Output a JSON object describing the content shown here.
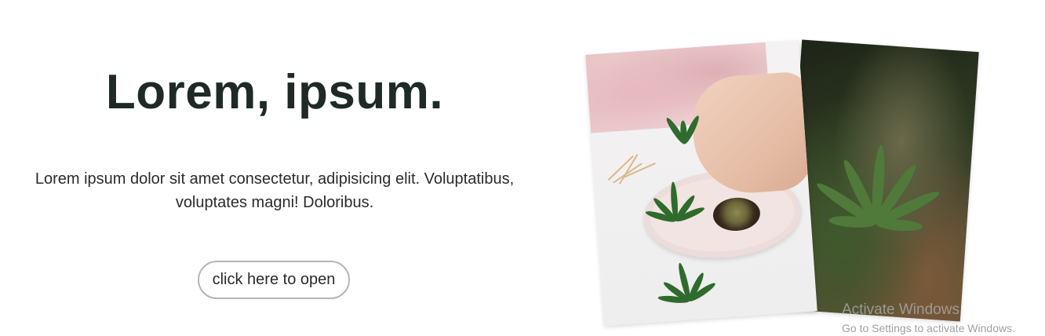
{
  "hero": {
    "title": "Lorem, ipsum.",
    "description": "Lorem ipsum dolor sit amet consectetur, adipisicing elit. Voluptatibus, voluptates magni! Doloribus.",
    "button_label": "click here to open"
  },
  "images": [
    {
      "name": "front-photo",
      "subject": "hands rolling on plate with leaves"
    },
    {
      "name": "back-photo",
      "subject": "cannabis plant close-up"
    }
  ],
  "watermark": {
    "title": "Activate Windows",
    "subtitle": "Go to Settings to activate Windows."
  },
  "colors": {
    "title": "#1f2a26",
    "button_border": "#b5b5b5",
    "background": "#ffffff"
  }
}
